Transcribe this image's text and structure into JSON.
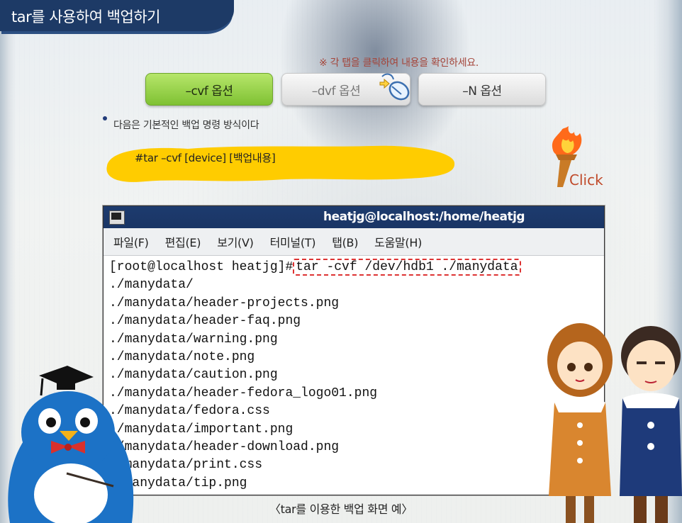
{
  "header": {
    "title": "tar를 사용하여 백업하기"
  },
  "notice": "※ 각 탭을 클릭하여 내용을 확인하세요.",
  "tabs": [
    {
      "label": "–cvf 옵션",
      "active": true
    },
    {
      "label": "–dvf 옵션",
      "active": false
    },
    {
      "label": "–N 옵션",
      "active": false
    }
  ],
  "description": "다음은 기본적인 백업 명령 방식이다",
  "command": "#tar –cvf [device] [백업내용]",
  "click_label": "Click",
  "terminal": {
    "title": "heatjg@localhost:/home/heatjg",
    "menu": [
      "파일(F)",
      "편집(E)",
      "보기(V)",
      "터미널(T)",
      "탭(B)",
      "도움말(H)"
    ],
    "prompt": "[root@localhost heatjg]#",
    "command": "tar -cvf /dev/hdb1 ./manydata",
    "output": [
      "./manydata/",
      "./manydata/header-projects.png",
      "./manydata/header-faq.png",
      "./manydata/warning.png",
      "./manydata/note.png",
      "./manydata/caution.png",
      "./manydata/header-fedora_logo01.png",
      "./manydata/fedora.css",
      "./manydata/important.png",
      "./manydata/header-download.png",
      "./manydata/print.css",
      "./manydata/tip.png"
    ]
  },
  "caption": "〈tar를 이용한 백업 화면 예〉",
  "colors": {
    "title_bg": "#1d3a66",
    "tab_active": "#8fcf3f",
    "highlight": "#d33",
    "blob": "#ffcc00"
  }
}
